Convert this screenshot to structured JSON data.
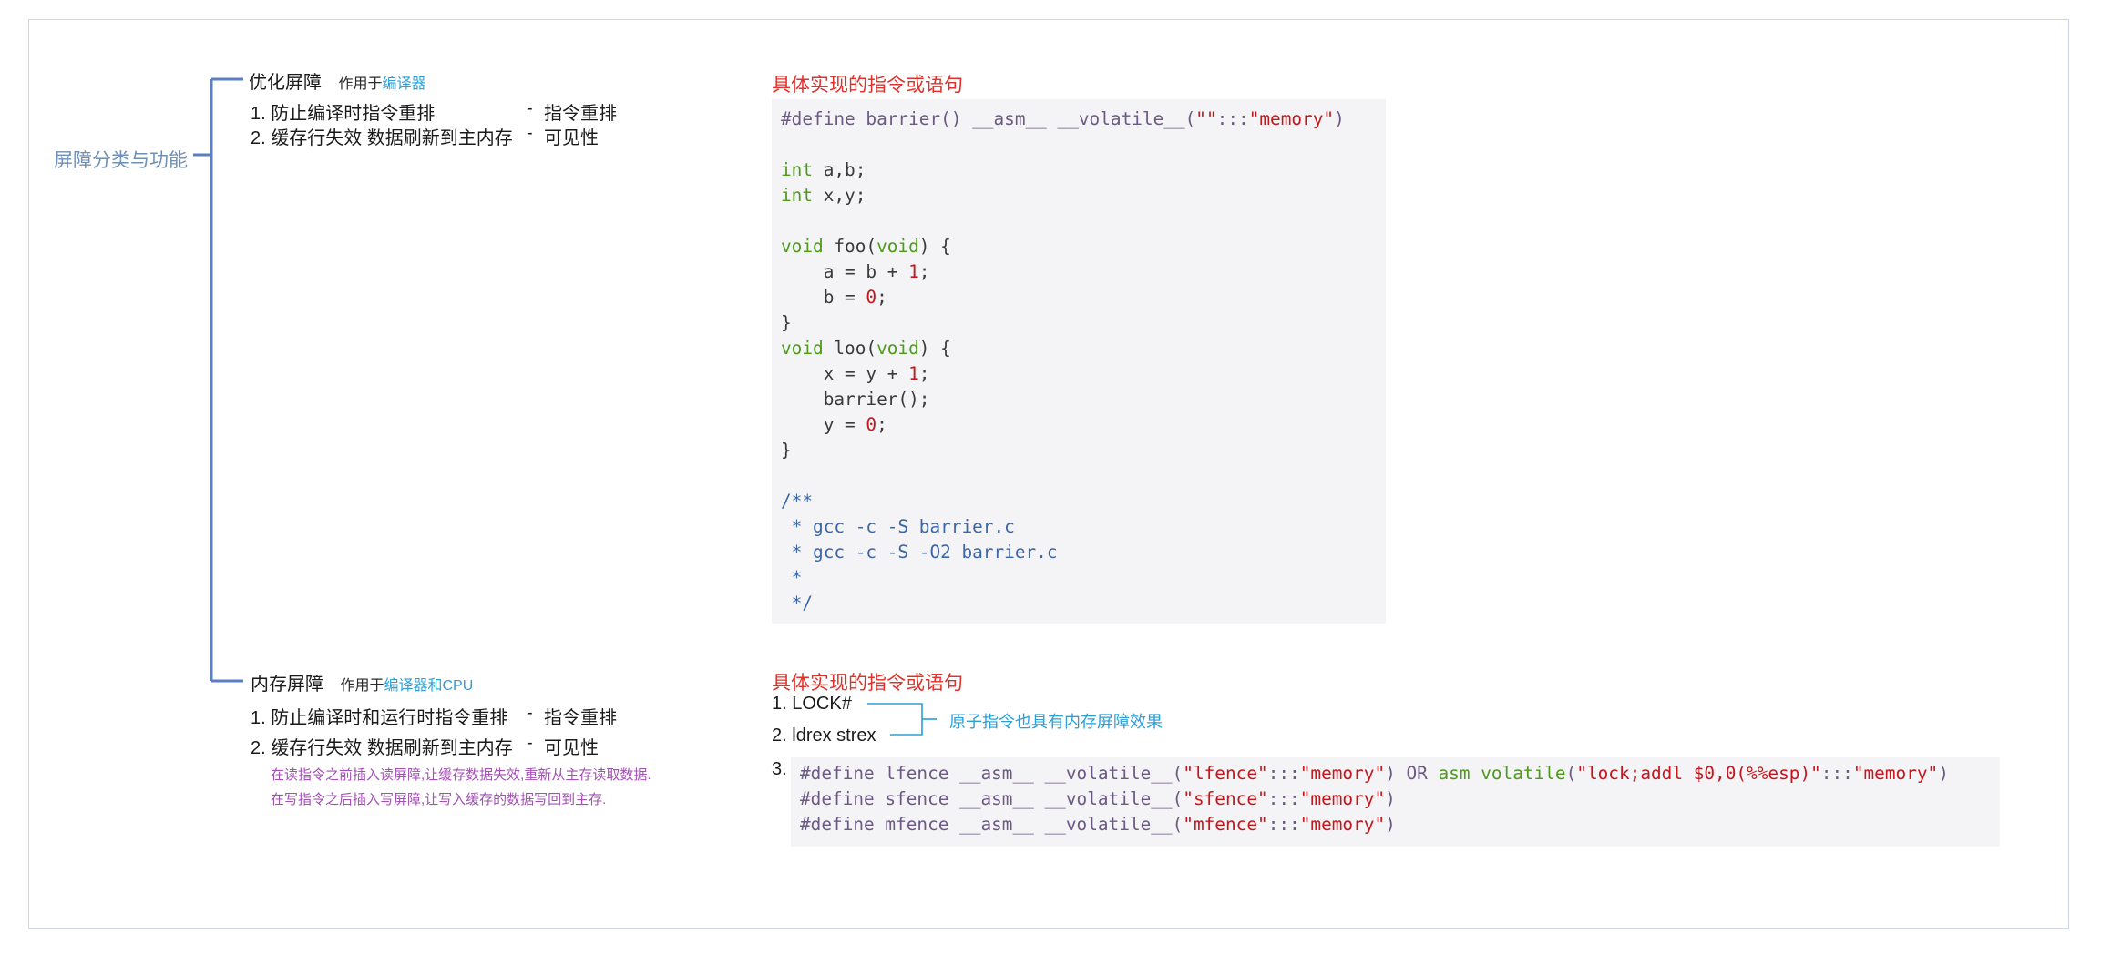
{
  "root": {
    "label": "屏障分类与功能"
  },
  "branches": {
    "compiler": {
      "title": "优化屏障",
      "scope_prefix": "作用于",
      "scope_highlight": "编译器",
      "items": [
        {
          "num": "1.",
          "text": "防止编译时指令重排",
          "dash": "-",
          "effect": "指令重排"
        },
        {
          "num": "2.",
          "text": "缓存行失效 数据刷新到主内存",
          "dash": "-",
          "effect": "可见性"
        }
      ]
    },
    "memory": {
      "title": "内存屏障",
      "scope_prefix": "作用于",
      "scope_highlight": "编译器和CPU",
      "items": [
        {
          "num": "1.",
          "text": "防止编译时和运行时指令重排",
          "dash": "-",
          "effect": "指令重排"
        },
        {
          "num": "2.",
          "text": "缓存行失效 数据刷新到主内存",
          "dash": "-",
          "effect": "可见性"
        }
      ],
      "notes": [
        "在读指令之前插入读屏障,让缓存数据失效,重新从主存读取数据.",
        "在写指令之后插入写屏障,让写入缓存的数据写回到主存."
      ]
    }
  },
  "implementation": {
    "heading_top": "具体实现的指令或语句",
    "heading_bottom": "具体实现的指令或语句",
    "instructions": [
      {
        "num": "1.",
        "text": "LOCK#"
      },
      {
        "num": "2.",
        "text": "ldrex strex"
      }
    ],
    "annotation": "原子指令也具有内存屏障效果",
    "item3_num": "3."
  },
  "code_top": [
    [
      [
        "pp",
        "#define barrier() __asm__ __volatile__("
      ],
      [
        "str",
        "\"\""
      ],
      [
        "pp",
        ":::"
      ],
      [
        "str",
        "\"memory\""
      ],
      [
        "pp",
        ")"
      ]
    ],
    [],
    [
      [
        "kw",
        "int"
      ],
      [
        "",
        " a,b;"
      ]
    ],
    [
      [
        "kw",
        "int"
      ],
      [
        "",
        " x,y;"
      ]
    ],
    [],
    [
      [
        "kw",
        "void"
      ],
      [
        "",
        " foo("
      ],
      [
        "kw",
        "void"
      ],
      [
        "",
        ") {"
      ]
    ],
    [
      [
        "",
        "    a = b + "
      ],
      [
        "num",
        "1"
      ],
      [
        "",
        ";"
      ]
    ],
    [
      [
        "",
        "    b = "
      ],
      [
        "num",
        "0"
      ],
      [
        "",
        ";"
      ]
    ],
    [
      [
        "",
        "}"
      ]
    ],
    [
      [
        "kw",
        "void"
      ],
      [
        "",
        " loo("
      ],
      [
        "kw",
        "void"
      ],
      [
        "",
        ") {"
      ]
    ],
    [
      [
        "",
        "    x = y + "
      ],
      [
        "num",
        "1"
      ],
      [
        "",
        ";"
      ]
    ],
    [
      [
        "",
        "    barrier();"
      ]
    ],
    [
      [
        "",
        "    y = "
      ],
      [
        "num",
        "0"
      ],
      [
        "",
        ";"
      ]
    ],
    [
      [
        "",
        "}"
      ]
    ],
    [],
    [
      [
        "cmt",
        "/**"
      ]
    ],
    [
      [
        "cmt",
        " * gcc -c -S barrier.c"
      ]
    ],
    [
      [
        "cmt",
        " * gcc -c -S -O2 barrier.c"
      ]
    ],
    [
      [
        "cmt",
        " *"
      ]
    ],
    [
      [
        "cmt",
        " */"
      ]
    ]
  ],
  "code_bottom": [
    [
      [
        "pp",
        "#define lfence __asm__ __volatile__("
      ],
      [
        "str",
        "\"lfence\""
      ],
      [
        "pp",
        ":::"
      ],
      [
        "str",
        "\"memory\""
      ],
      [
        "pp",
        ") OR "
      ],
      [
        "kw",
        "asm volatile"
      ],
      [
        "pp",
        "("
      ],
      [
        "str",
        "\"lock;addl $0,0(%%esp)\""
      ],
      [
        "pp",
        ":::"
      ],
      [
        "str",
        "\"memory\""
      ],
      [
        "pp",
        ")"
      ]
    ],
    [
      [
        "pp",
        "#define sfence __asm__ __volatile__("
      ],
      [
        "str",
        "\"sfence\""
      ],
      [
        "pp",
        ":::"
      ],
      [
        "str",
        "\"memory\""
      ],
      [
        "pp",
        ")"
      ]
    ],
    [
      [
        "pp",
        "#define mfence __asm__ __volatile__("
      ],
      [
        "str",
        "\"mfence\""
      ],
      [
        "pp",
        ":::"
      ],
      [
        "str",
        "\"memory\""
      ],
      [
        "pp",
        ")"
      ]
    ]
  ],
  "colors": {
    "tree_line": "#5b7fc2",
    "heading_red": "#e0322c",
    "highlight_blue": "#2a9fd8",
    "note_purple": "#a34fb5",
    "code_bg": "#f4f3f5"
  }
}
